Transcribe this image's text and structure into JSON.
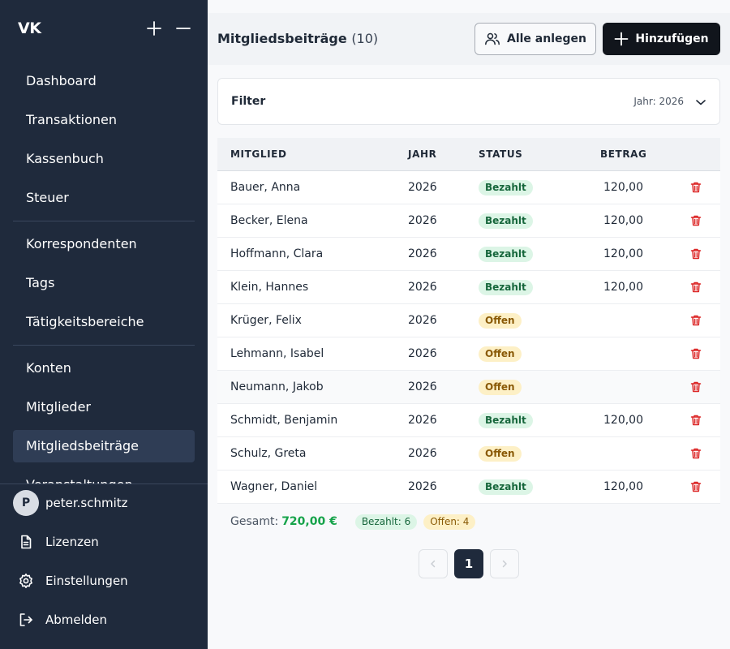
{
  "sidebar": {
    "brand": "VK",
    "nav_groups": [
      [
        "Dashboard",
        "Transaktionen",
        "Kassenbuch",
        "Steuer"
      ],
      [
        "Korrespondenten",
        "Tags",
        "Tätigkeitsbereiche"
      ],
      [
        "Konten",
        "Mitglieder",
        "Mitgliedsbeiträge",
        "Veranstaltungen"
      ]
    ],
    "active_item": "Mitgliedsbeiträge",
    "user": {
      "initial": "P",
      "name": "peter.schmitz"
    },
    "links": {
      "licenses": "Lizenzen",
      "settings": "Einstellungen",
      "logout": "Abmelden"
    }
  },
  "header": {
    "title": "Mitgliedsbeiträge",
    "count": "(10)",
    "create_all_label": "Alle anlegen",
    "add_label": "Hinzufügen"
  },
  "filter": {
    "title": "Filter",
    "year_label": "Jahr: 2026"
  },
  "table": {
    "columns": [
      "MITGLIED",
      "JAHR",
      "STATUS",
      "BETRAG"
    ],
    "rows": [
      {
        "member": "Bauer, Anna",
        "year": "2026",
        "status": "Bezahlt",
        "amount": "120,00"
      },
      {
        "member": "Becker, Elena",
        "year": "2026",
        "status": "Bezahlt",
        "amount": "120,00"
      },
      {
        "member": "Hoffmann, Clara",
        "year": "2026",
        "status": "Bezahlt",
        "amount": "120,00"
      },
      {
        "member": "Klein, Hannes",
        "year": "2026",
        "status": "Bezahlt",
        "amount": "120,00"
      },
      {
        "member": "Krüger, Felix",
        "year": "2026",
        "status": "Offen",
        "amount": ""
      },
      {
        "member": "Lehmann, Isabel",
        "year": "2026",
        "status": "Offen",
        "amount": ""
      },
      {
        "member": "Neumann, Jakob",
        "year": "2026",
        "status": "Offen",
        "amount": ""
      },
      {
        "member": "Schmidt, Benjamin",
        "year": "2026",
        "status": "Bezahlt",
        "amount": "120,00"
      },
      {
        "member": "Schulz, Greta",
        "year": "2026",
        "status": "Offen",
        "amount": ""
      },
      {
        "member": "Wagner, Daniel",
        "year": "2026",
        "status": "Bezahlt",
        "amount": "120,00"
      }
    ]
  },
  "summary": {
    "total_label": "Gesamt:",
    "total_value": "720,00 €",
    "paid_badge": "Bezahlt: 6",
    "open_badge": "Offen: 4"
  },
  "pagination": {
    "current": "1"
  },
  "colors": {
    "sidebar_bg": "#1f2a3c",
    "sidebar_active": "#2f3d55",
    "primary_button": "#11151c",
    "paid_bg": "#dcf5e6",
    "paid_text": "#17673c",
    "open_bg": "#fdf0c6",
    "open_text": "#8a5a06",
    "total_green": "#16a34a",
    "trash_red": "#dc2626"
  },
  "icons": {
    "add": "plus-icon",
    "collapse": "minus-icon",
    "create_all": "users-icon",
    "filter_toggle": "chevron-down-icon",
    "delete": "trash-icon",
    "licenses": "document-icon",
    "settings": "gear-icon",
    "logout": "logout-icon",
    "prev": "chevron-left-icon",
    "next": "chevron-right-icon"
  }
}
